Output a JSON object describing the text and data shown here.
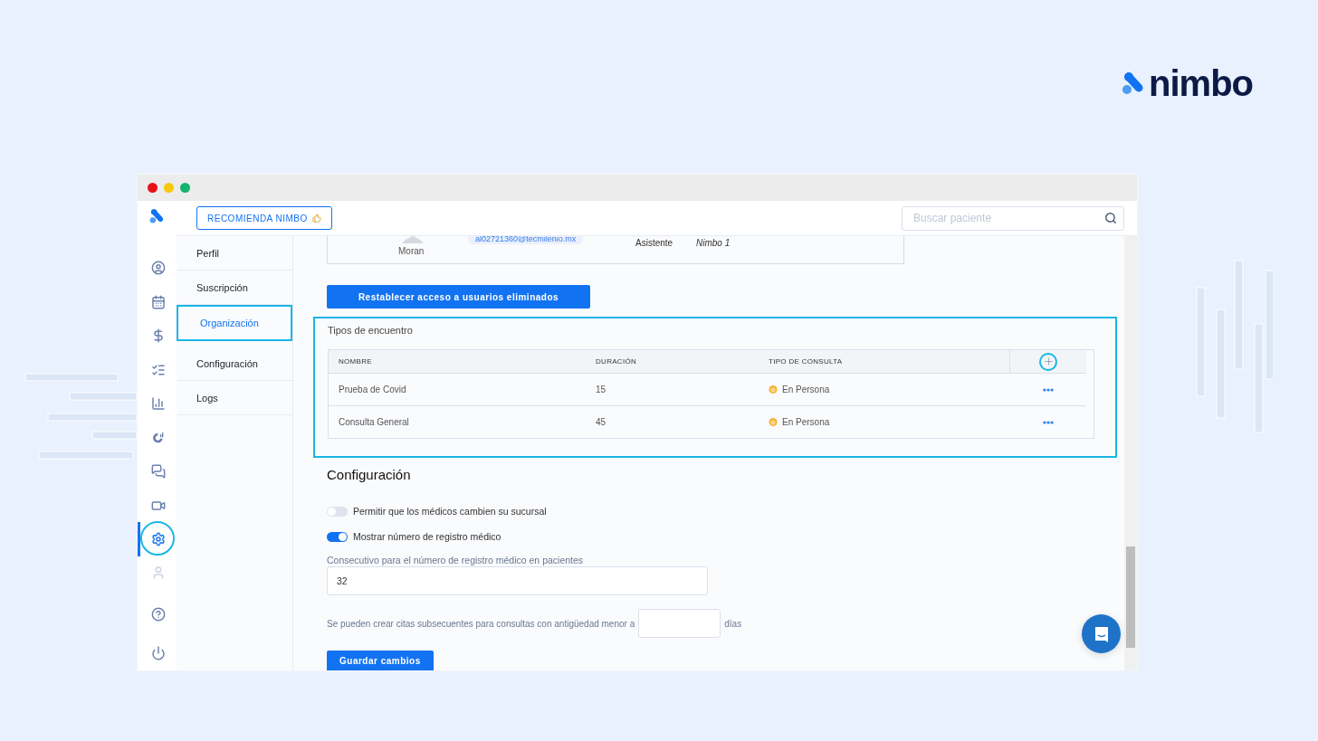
{
  "logo": {
    "text": "nimbo"
  },
  "window": {
    "controls": [
      {
        "color": "#e8101a"
      },
      {
        "color": "#f8c80c"
      },
      {
        "color": "#15b36b"
      }
    ]
  },
  "rail": {
    "items": [
      {
        "selected": false
      },
      {
        "selected": false
      },
      {
        "selected": false
      },
      {
        "selected": false
      },
      {
        "selected": false
      },
      {
        "selected": false
      },
      {
        "selected": false
      },
      {
        "selected": false
      },
      {
        "selected": true
      },
      {
        "selected": false
      },
      {
        "selected": false
      },
      {
        "selected": false
      }
    ]
  },
  "header": {
    "recommend_button": "RECOMIENDA NIMBO",
    "search": {
      "placeholder": "Buscar paciente"
    }
  },
  "submenu": [
    {
      "label": "Perfil",
      "selected": false
    },
    {
      "label": "Suscripción",
      "selected": false
    },
    {
      "label": "Organización",
      "selected": true
    },
    {
      "label": "Configuración",
      "selected": false
    },
    {
      "label": "Logs",
      "selected": false
    }
  ],
  "user_card": {
    "name": "Moran",
    "email": "al02721360@tecmilenio.mx",
    "role": "Asistente",
    "branch": "Nimbo 1"
  },
  "restore_button": "Restablecer acceso a usuarios eliminados",
  "encounter_types": {
    "title": "Tipos de encuentro",
    "columns": [
      "NOMBRE",
      "DURACIÓN",
      "TIPO DE CONSULTA"
    ],
    "rows": [
      {
        "name": "Prueba de Covid",
        "duration": "15",
        "type": "En Persona"
      },
      {
        "name": "Consulta General",
        "duration": "45",
        "type": "En Persona"
      }
    ]
  },
  "settings": {
    "title": "Configuración",
    "toggles": [
      {
        "label": "Permitir que los médicos cambien su sucursal",
        "on": false
      },
      {
        "label": "Mostrar número de registro médico",
        "on": true
      }
    ],
    "consecutive": {
      "label": "Consecutivo para el número de registro médico en pacientes",
      "value": "32"
    },
    "subsequent": {
      "label": "Se pueden crear citas subsecuentes para consultas con antigüedad menor a",
      "suffix": "días"
    },
    "save_button": "Guardar cambios"
  }
}
